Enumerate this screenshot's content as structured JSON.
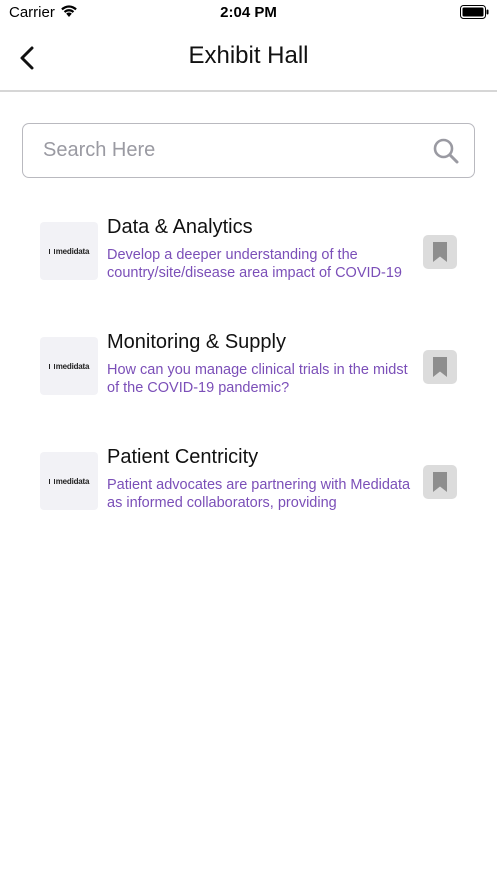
{
  "status_bar": {
    "carrier": "Carrier",
    "time": "2:04 PM"
  },
  "nav": {
    "title": "Exhibit Hall",
    "back_icon": "chevron-left-icon"
  },
  "search": {
    "placeholder": "Search Here",
    "value": "",
    "icon": "search-icon"
  },
  "exhibitors": [
    {
      "logo_text": "medidata",
      "title": "Data & Analytics",
      "description": "Develop a deeper understanding of the country/site/disease area impact of COVID-19",
      "bookmarked": false
    },
    {
      "logo_text": "medidata",
      "title": "Monitoring & Supply",
      "description": "How can you manage clinical trials in the midst of the COVID-19 pandemic?",
      "bookmarked": false
    },
    {
      "logo_text": "medidata",
      "title": "Patient Centricity",
      "description": "Patient advocates are partnering with Medidata as informed collaborators, providing",
      "bookmarked": false
    }
  ],
  "colors": {
    "accent_purple": "#7b4fb8",
    "bookmark_bg": "#dcdcdc",
    "bookmark_icon": "#8e8e8e"
  }
}
